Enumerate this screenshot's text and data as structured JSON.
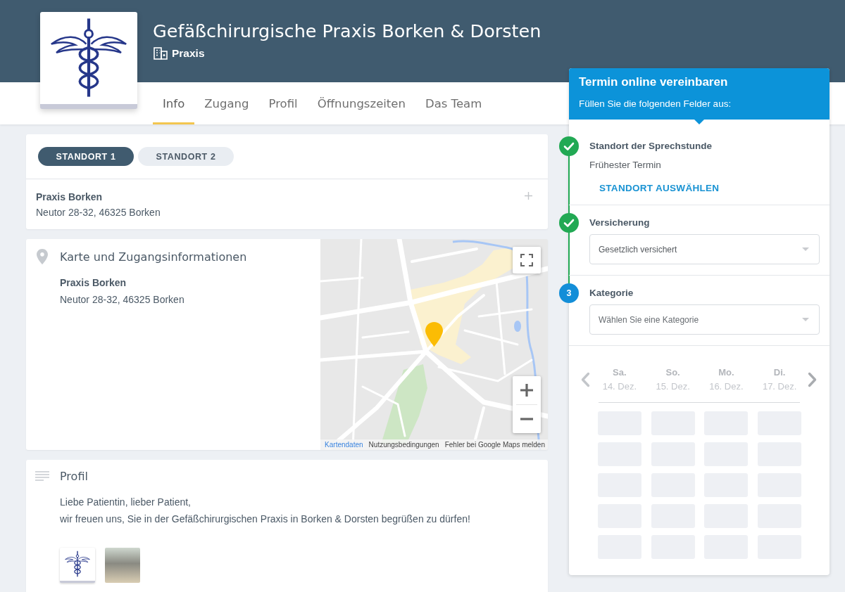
{
  "header": {
    "title": "Gefäßchirurgische Praxis Borken & Dorsten",
    "category": "Praxis"
  },
  "tabs": [
    {
      "label": "Info",
      "selected": true
    },
    {
      "label": "Zugang",
      "selected": false
    },
    {
      "label": "Profil",
      "selected": false
    },
    {
      "label": "Öffnungszeiten",
      "selected": false
    },
    {
      "label": "Das Team",
      "selected": false
    }
  ],
  "locations": {
    "tabs": [
      {
        "label": "STANDORT 1",
        "selected": true
      },
      {
        "label": "STANDORT 2",
        "selected": false
      }
    ],
    "name": "Praxis Borken",
    "address": "Neutor 28-32, 46325 Borken"
  },
  "access": {
    "title": "Karte und Zugangsinformationen",
    "name": "Praxis Borken",
    "address": "Neutor 28-32, 46325 Borken",
    "map_links": [
      "Kartendaten",
      "Nutzungsbedingungen",
      "Fehler bei Google Maps melden"
    ]
  },
  "profile": {
    "title": "Profil",
    "lines": [
      "Liebe Patientin, lieber Patient,",
      "wir freuen uns, Sie in der Gefäßchirurgischen Praxis in Borken & Dorsten begrüßen zu dürfen!"
    ],
    "thumbnails": [
      {
        "kind": "logo"
      },
      {
        "kind": "photo"
      }
    ]
  },
  "booking": {
    "title": "Termin online vereinbaren",
    "subtitle": "Füllen Sie die folgenden Felder aus:",
    "steps": [
      {
        "kind": "location",
        "completed": true,
        "title": "Standort der Sprechstunde",
        "detail": "Frühester Termin",
        "action": "STANDORT AUSWÄHLEN"
      },
      {
        "kind": "select",
        "completed": true,
        "title": "Versicherung",
        "value": "Gesetzlich versichert"
      },
      {
        "kind": "select",
        "completed": false,
        "number": "3",
        "title": "Kategorie",
        "placeholder": "Wählen Sie eine Kategorie"
      }
    ],
    "days": [
      {
        "weekday": "Sa.",
        "date": "14. Dez."
      },
      {
        "weekday": "So.",
        "date": "15. Dez."
      },
      {
        "weekday": "Mo.",
        "date": "16. Dez."
      },
      {
        "weekday": "Di.",
        "date": "17. Dez."
      }
    ]
  }
}
